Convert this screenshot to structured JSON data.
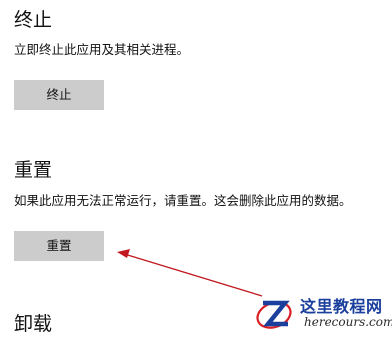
{
  "terminate": {
    "title": "终止",
    "description": "立即终止此应用及其相关进程。",
    "button_label": "终止"
  },
  "reset": {
    "title": "重置",
    "description": "如果此应用无法正常运行，请重置。这会删除此应用的数据。",
    "button_label": "重置"
  },
  "uninstall": {
    "title": "卸载"
  },
  "annotation": {
    "arrow_color": "#c0181e"
  },
  "watermark": {
    "name": "这里教程网",
    "domain": "herecours.com",
    "name_color": "#1b3f9c",
    "logo_colors": [
      "#1b3f9c",
      "#d81e24"
    ]
  },
  "colors": {
    "button_bg": "#cccccc",
    "page_bg": "#ffffff"
  }
}
